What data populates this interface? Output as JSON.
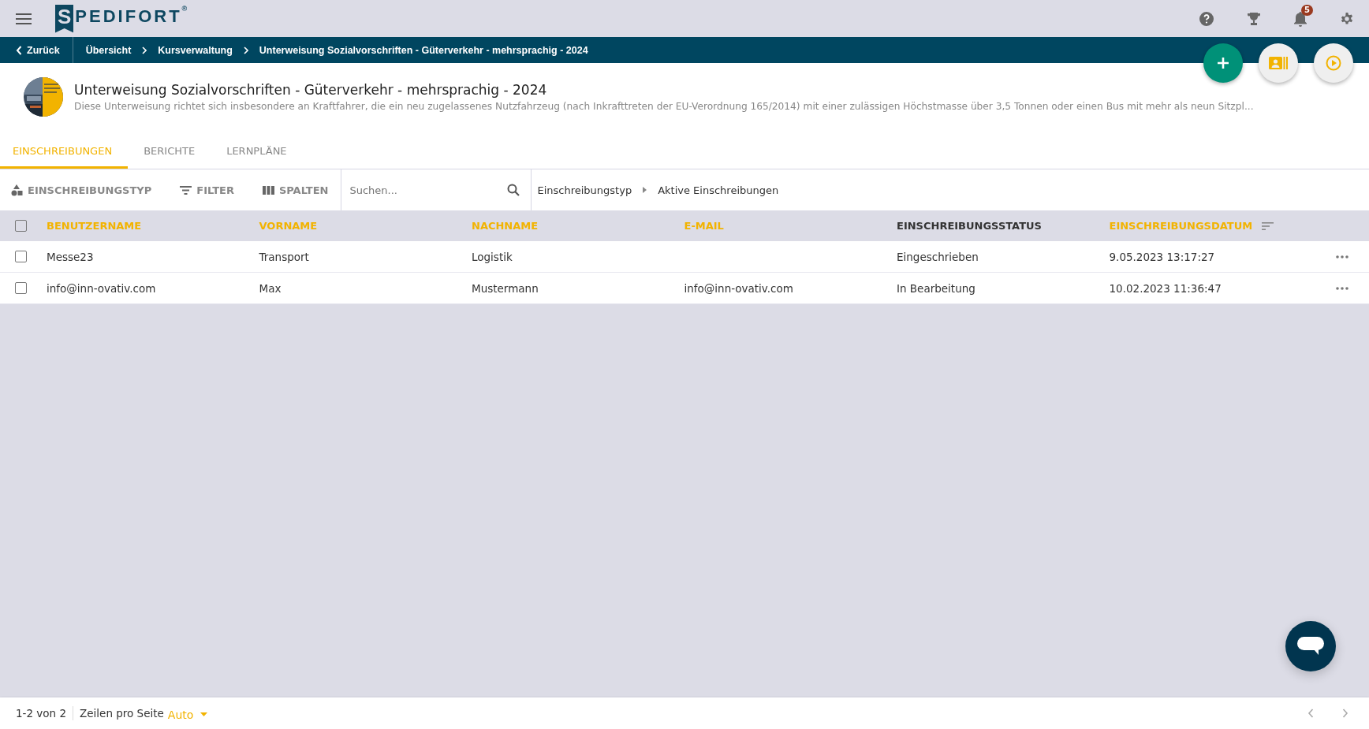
{
  "logo": {
    "mark": "S",
    "text": "PEDIFORT",
    "registered": "®"
  },
  "top_bar": {
    "notification_count": "5"
  },
  "breadcrumb": {
    "back": "Zurück",
    "items": [
      "Übersicht",
      "Kursverwaltung",
      "Unterweisung Sozialvorschriften - Güterverkehr - mehrsprachig - 2024"
    ]
  },
  "course": {
    "kind": "picture",
    "title": "Unterweisung Sozialvorschriften - Güterverkehr - mehrsprachig - 2024",
    "description": "Diese Unterweisung richtet sich insbesondere an Kraftfahrer, die ein neu zugelassenes Nutzfahrzeug (nach Inkrafttreten der EU-Verordnung 165/2014) mit einer zulässigen Höchstmasse über 3,5 Tonnen oder einen Bus mit mehr als neun Sitzpl..."
  },
  "tabs": [
    {
      "label": "EINSCHREIBUNGEN",
      "selected": true
    },
    {
      "label": "BERICHTE",
      "selected": false
    },
    {
      "label": "LERNPLÄNE",
      "selected": false
    }
  ],
  "toolbar": {
    "buttons": [
      {
        "kind": "type",
        "label": "EINSCHREIBUNGSTYP"
      },
      {
        "kind": "filter",
        "label": "FILTER"
      },
      {
        "kind": "columns",
        "label": "SPALTEN"
      }
    ],
    "search": {
      "placeholder": "Suchen..."
    },
    "filter_path": [
      "Einschreibungstyp",
      "Aktive Einschreibungen"
    ]
  },
  "table": {
    "all_checked": false,
    "columns": [
      {
        "label": "BENUTZERNAME",
        "sortable": true,
        "sorted": false
      },
      {
        "label": "VORNAME",
        "sortable": true,
        "sorted": false
      },
      {
        "label": "NACHNAME",
        "sortable": true,
        "sorted": false
      },
      {
        "label": "E-MAIL",
        "sortable": true,
        "sorted": false
      },
      {
        "label": "EINSCHREIBUNGSSTATUS",
        "sortable": false,
        "sorted": false
      },
      {
        "label": "EINSCHREIBUNGSDATUM",
        "sortable": true,
        "sorted": true
      }
    ],
    "rows": [
      {
        "selected": false,
        "cells": [
          "Messe23",
          "Transport",
          "Logistik",
          "",
          "Eingeschrieben",
          "9.05.2023 13:17:27"
        ]
      },
      {
        "selected": false,
        "cells": [
          "info@inn-ovativ.com",
          "Max",
          "Mustermann",
          "info@inn-ovativ.com",
          "In Bearbeitung",
          "10.02.2023 11:36:47"
        ]
      }
    ]
  },
  "footer": {
    "range": "1-2 von 2",
    "rows_per_page_label": "Zeilen pro Seite",
    "rows_per_page_value": "Auto"
  }
}
